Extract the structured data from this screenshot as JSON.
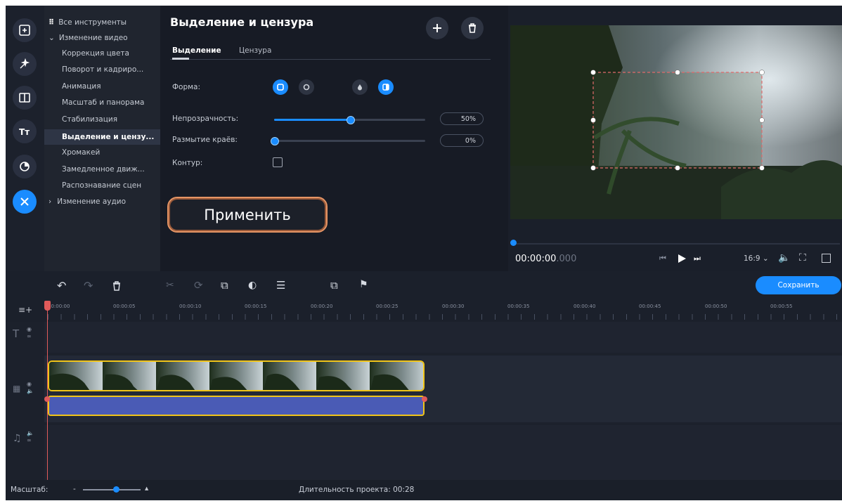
{
  "sidebar_tools": {
    "all_tools": "Все инструменты",
    "video_group": "Изменение видео",
    "items": [
      "Коррекция цвета",
      "Поворот и кадриро...",
      "Анимация",
      "Масштаб и панорама",
      "Стабилизация",
      "Выделение и цензу...",
      "Хромакей",
      "Замедленное движ...",
      "Распознавание сцен"
    ],
    "audio_group": "Изменение аудио"
  },
  "panel": {
    "title": "Выделение и цензура",
    "tabs": [
      "Выделение",
      "Цензура"
    ],
    "shape_label": "Форма:",
    "opacity_label": "Непрозрачность:",
    "opacity_value": "50%",
    "opacity_fraction": 0.5,
    "blur_label": "Размытие краёв:",
    "blur_value": "0%",
    "blur_fraction": 0.0,
    "outline_label": "Контур:",
    "apply_label": "Применить"
  },
  "player": {
    "time_main": "00:00:00",
    "time_ms": ".000",
    "aspect": "16:9"
  },
  "toolbar": {
    "save_label": "Сохранить"
  },
  "ruler_ticks": [
    "00:00:00",
    "00:00:05",
    "00:00:10",
    "00:00:15",
    "00:00:20",
    "00:00:25",
    "00:00:30",
    "00:00:35",
    "00:00:40",
    "00:00:45",
    "00:00:50",
    "00:00:55"
  ],
  "status": {
    "scale_label": "Масштаб:",
    "duration": "Длительность проекта: 00:28"
  },
  "colors": {
    "accent": "#1a8cff",
    "highlight_outline": "#e69565",
    "clip_border": "#f0c419",
    "audio_fill": "#4a5bb5"
  }
}
